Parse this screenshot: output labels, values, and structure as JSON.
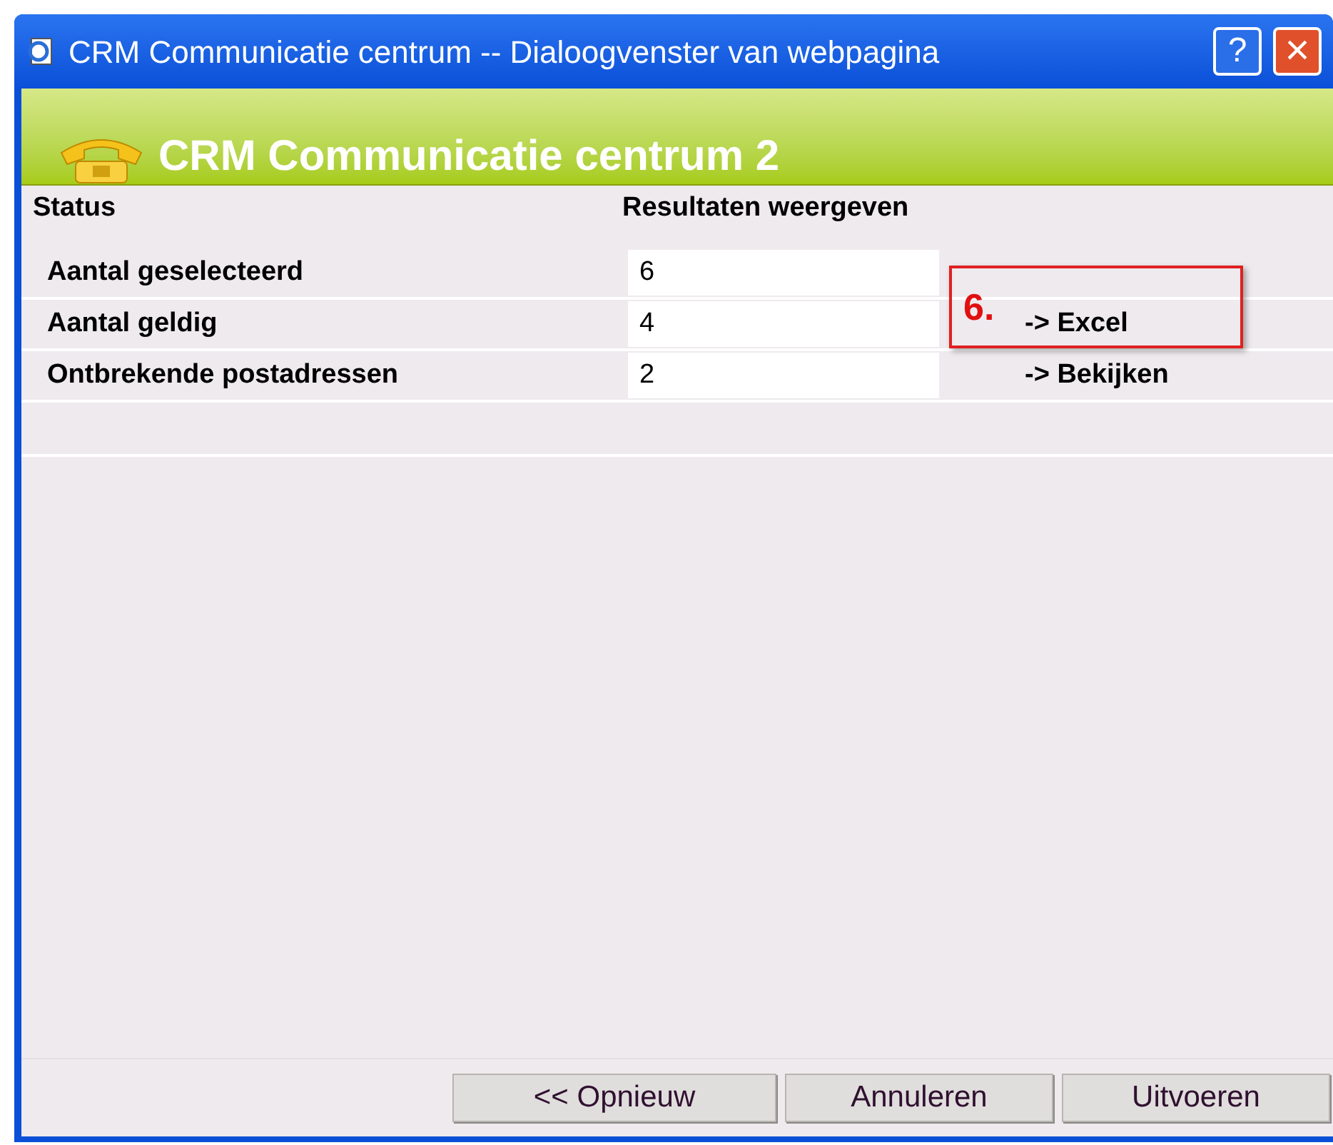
{
  "window": {
    "title": "CRM Communicatie centrum -- Dialoogvenster van webpagina",
    "help": "?",
    "close": "×"
  },
  "header": {
    "title": "CRM Communicatie centrum 2"
  },
  "columns": [
    "Status",
    "Resultaten weergeven"
  ],
  "rows": [
    {
      "label": "Aantal geselecteerd",
      "value": "6"
    },
    {
      "label": "Aantal geldig",
      "value": "4",
      "link": "-> Excel"
    },
    {
      "label": "Ontbrekende postadressen",
      "value": "2",
      "link": "-> Bekijken"
    }
  ],
  "annotation": {
    "number": "6."
  },
  "buttons": [
    "<< Opnieuw",
    "Annuleren",
    "Uitvoeren"
  ]
}
